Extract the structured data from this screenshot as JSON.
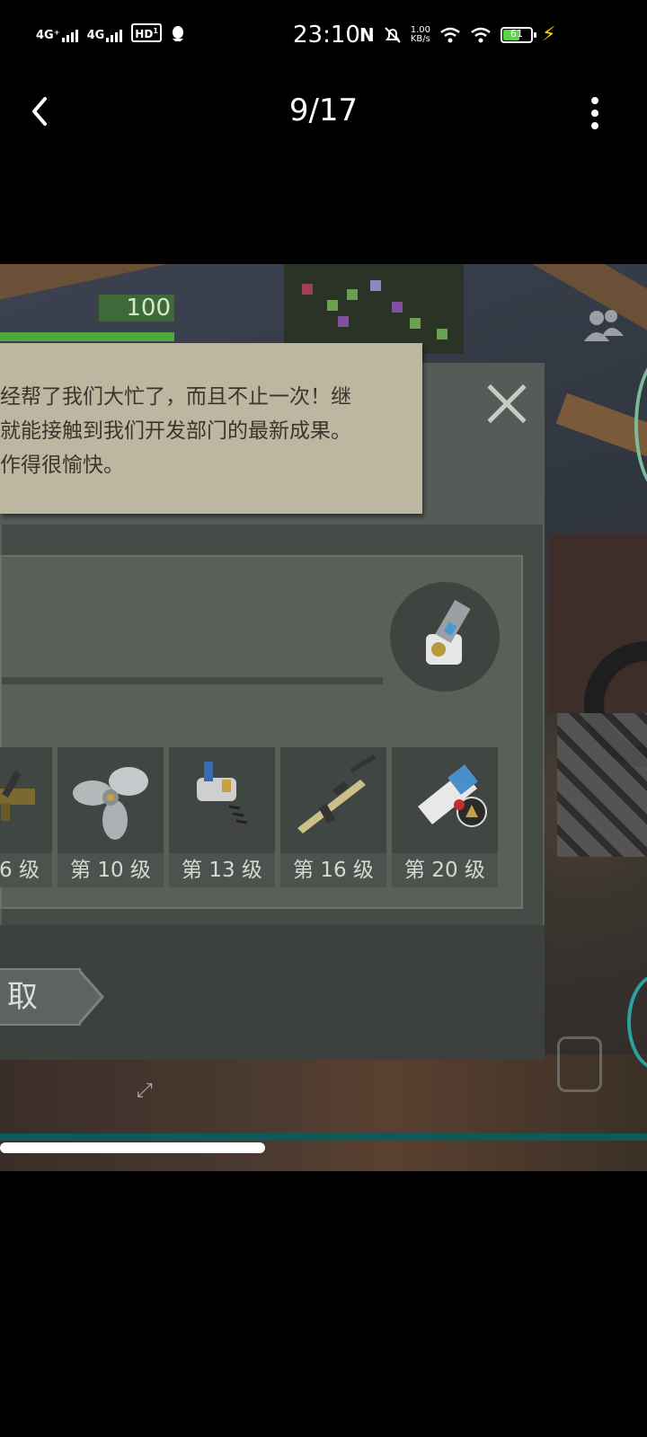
{
  "status_bar": {
    "network1": "4G⁺",
    "network2": "4G",
    "hd": "HD",
    "hd_sub": "1",
    "time": "23:10",
    "speed_top": "1.00",
    "speed_bottom": "KB/s",
    "battery": "61",
    "battery_level": 0.61,
    "battery_color": "#5ad24a"
  },
  "header": {
    "counter": "9/17"
  },
  "game": {
    "hp_value": "100",
    "dialog": {
      "quote_lines": [
        "经帮了我们大忙了，而且不止一次！继",
        "就能接触到我们开发部门的最新成果。",
        "作得很愉快。"
      ],
      "items": [
        {
          "label": "6 级",
          "icon": "gun-part-icon"
        },
        {
          "label": "第 10 级",
          "icon": "propeller-icon"
        },
        {
          "label": "第 13 级",
          "icon": "drill-icon"
        },
        {
          "label": "第 16 级",
          "icon": "rifle-icon"
        },
        {
          "label": "第 20 级",
          "icon": "blueprint-icon"
        }
      ],
      "claim_label": "取"
    }
  },
  "video": {
    "progress": 0.41,
    "accent": "#0d5a5a"
  }
}
